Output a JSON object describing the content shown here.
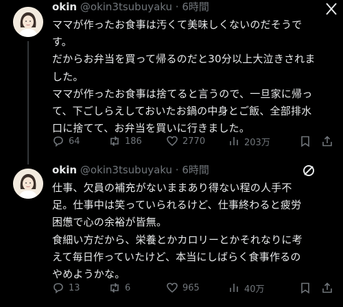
{
  "tweets": [
    {
      "name": "okin",
      "handle": "@okin3tsubuyaku",
      "separator": "·",
      "time": "6時間",
      "lines": [
        "ママが作ったお食事は汚くて美味しくないのだそうで",
        "す。",
        "だからお弁当を買って帰るのだと30分以上大泣きされま",
        "した。",
        "ママが作ったお食事は捨てると言うので、一旦家に帰っ",
        "て、下ごしらえしておいたお鍋の中身とご飯、全部排水",
        "口に捨てて、お弁当を買いに行きました。"
      ],
      "replies": "64",
      "retweets": "186",
      "likes": "2770",
      "views": "203万"
    },
    {
      "name": "okin",
      "handle": "@okin3tsubuyaku",
      "separator": "·",
      "time": "6時間",
      "lines": [
        "仕事、欠員の補充がないままあり得ない程の人手不",
        "足。仕事中は笑っていられるけど、仕事終わると疲労",
        "困憊で心の余裕が皆無。",
        "食細い方だから、栄養とかカロリーとかそれなりに考",
        "えて毎日作っていたけど、本当にしばらく食事作るの",
        "やめようかな。"
      ],
      "replies": "13",
      "retweets": "6",
      "likes": "965",
      "views": "40万"
    }
  ]
}
